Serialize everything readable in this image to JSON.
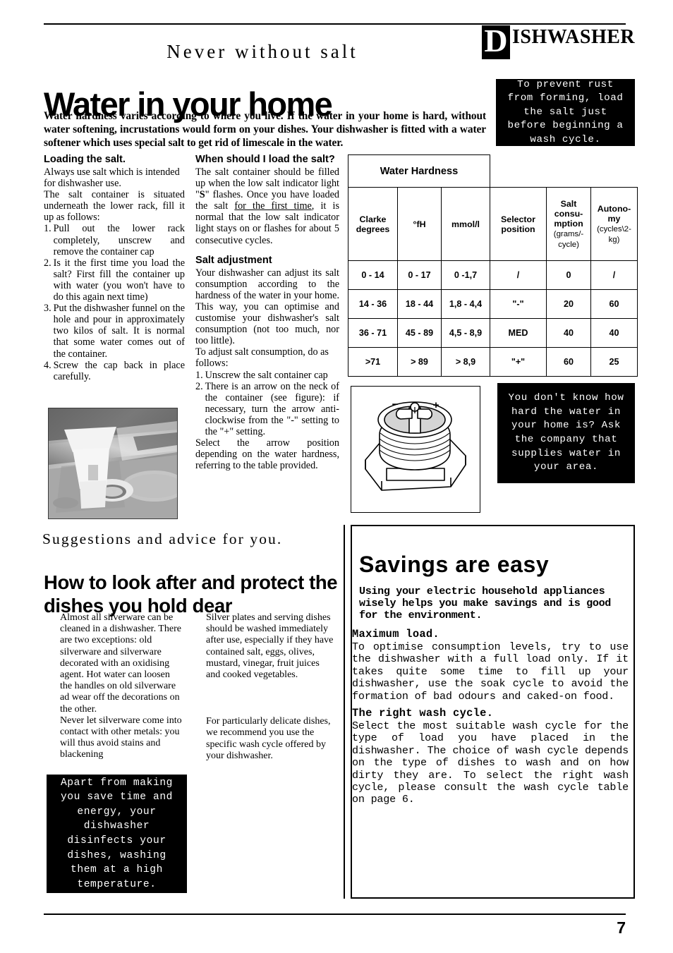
{
  "masthead": {
    "initial": "D",
    "rest": "ISHWASHER"
  },
  "header": {
    "kicker": "Never without salt",
    "title": "Water in your home",
    "intro": "Water hardness varies according to where you live. If the water in your home is hard, without water softening, incrustations would form on your dishes. Your dishwasher is fitted with a water softener which uses special salt to get rid of limescale in the water."
  },
  "callouts": {
    "rust": "To prevent rust from forming, load the salt just before beginning a wash cycle.",
    "hardness": "You don't know how hard the water in your home is? Ask the company that supplies water in your area.",
    "disinfect": "Apart from making you save time and energy, your dishwasher disinfects your dishes, washing them at a high temperature."
  },
  "column1": {
    "heading": "Loading the salt.",
    "p1": "Always use salt which is intended for dishwasher use.",
    "p2": "The salt container is situated underneath the lower rack, fill it up as follows:",
    "steps": [
      {
        "num": "1.",
        "text": "Pull out the lower rack completely, unscrew and remove the container cap"
      },
      {
        "num": "2.",
        "text": "Is it the first time you load the salt? First fill the container up with water (you won't have to do this again next time)"
      },
      {
        "num": "3.",
        "text": "Put the dishwasher funnel on the hole and pour in approximately two kilos of salt. It is normal that some water comes out of the container."
      },
      {
        "num": "4.",
        "text": "Screw the cap back in place carefully."
      }
    ]
  },
  "column2": {
    "heading1": "When should I load the salt?",
    "p1a": "The salt container should be filled up when the low salt indicator light \"",
    "p1_bold": "S",
    "p1b": "\" flashes. Once you have loaded the salt ",
    "p1_underline": "for the first time",
    "p1c": ", it is normal that the low salt indicator light stays on or flashes for about 5 consecutive cycles.",
    "heading2": "Salt adjustment",
    "p2": "Your dishwasher can adjust its salt consumption according to the hardness of the water in your home. This way, you can optimise and customise your dishwasher's salt consumption (not too much, nor too little).",
    "p3": "To adjust salt consumption, do as follows:",
    "steps": [
      {
        "num": "1.",
        "text": "Unscrew the salt container cap"
      },
      {
        "num": "2.",
        "text": "There is an arrow on the neck of the container (see figure): if necessary, turn the arrow anti-clockwise from the \"-\" setting to the \"+\" setting."
      }
    ],
    "p4": "Select the arrow position depending on the water hardness, referring to the table provided."
  },
  "table": {
    "group_header": "Water Hardness",
    "headers": [
      {
        "main": "Clarke degrees",
        "sub": ""
      },
      {
        "main": "°fH",
        "sub": ""
      },
      {
        "main": "mmol/l",
        "sub": ""
      },
      {
        "main": "Selector position",
        "sub": ""
      },
      {
        "main": "Salt consu-mption",
        "sub": "(grams/-cycle)"
      },
      {
        "main": "Autono-my",
        "sub": "(cycles\\2-kg)"
      }
    ],
    "rows": [
      [
        "0 - 14",
        "0 - 17",
        "0 -1,7",
        "/",
        "0",
        "/"
      ],
      [
        "14 - 36",
        "18 - 44",
        "1,8 - 4,4",
        "\"-\"",
        "20",
        "60"
      ],
      [
        "36 - 71",
        "45 -  89",
        "4,5 -  8,9",
        "MED",
        "40",
        "40"
      ],
      [
        ">71",
        "> 89",
        "> 8,9",
        "\"+\"",
        "60",
        "25"
      ]
    ]
  },
  "figure": {
    "minus_label": "−",
    "plus_label": "+",
    "caption": ""
  },
  "advice": {
    "kicker": "Suggestions and advice for you.",
    "title": "How to look after and protect the dishes you hold dear",
    "col1_p1": "Almost all silverware can be cleaned in a dishwasher. There are two exceptions: old silverware and silverware decorated with an oxidising agent. Hot water can loosen the handles on old silverware ad wear off the decorations on the other.",
    "col1_p2": "Never let silverware come into contact with other metals: you will thus avoid stains and blackening",
    "col2_p1": "Silver plates and serving dishes should be washed immediately after use, especially if they have contained salt, eggs, olives, mustard, vinegar, fruit juices and cooked vegetables.",
    "col2_p2": "For particularly delicate dishes, we recommend you use the specific wash cycle offered by your dishwasher."
  },
  "savings": {
    "title": "Savings are easy",
    "lead": "Using your electric household appliances wisely helps you make savings and is good for the environment.",
    "section1_title": "Maximum  load.",
    "section1_body": "To optimise consumption levels, try to use the dishwasher with a full load only. If it takes quite some time to fill up your dishwasher, use the soak cycle to avoid the formation of bad odours and caked-on food.",
    "section2_title": "The right wash cycle.",
    "section2_body": "Select the most suitable wash cycle for the type of load you have placed in the dishwasher. The choice of wash cycle depends on the type of dishes to wash and on how dirty they are. To select the right wash cycle, please consult the wash cycle table on page 6."
  },
  "footer": {
    "page_number": "7"
  }
}
